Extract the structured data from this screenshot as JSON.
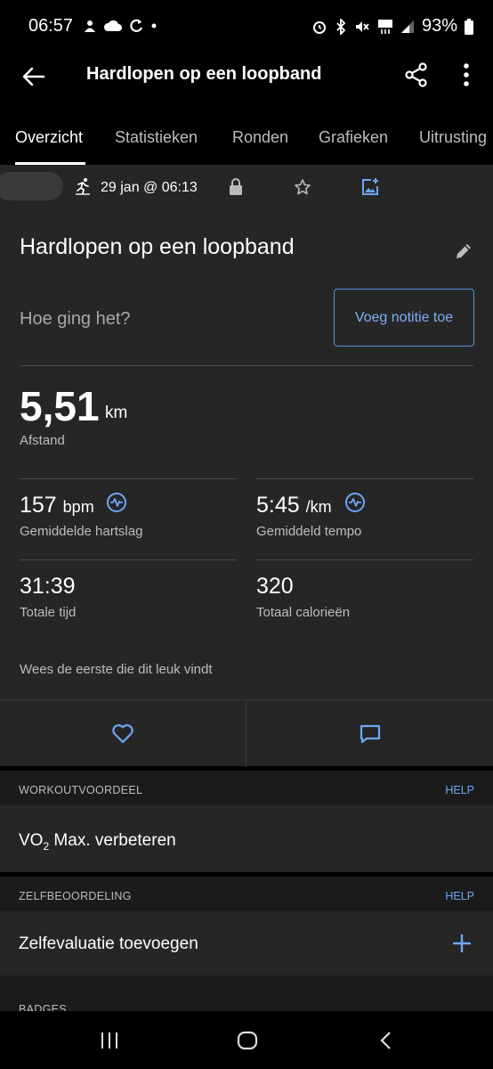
{
  "status_bar": {
    "time": "06:57",
    "battery": "93%"
  },
  "app_bar": {
    "title": "Hardlopen op een loopband"
  },
  "tabs": [
    {
      "label": "Overzicht",
      "active": true
    },
    {
      "label": "Statistieken",
      "active": false
    },
    {
      "label": "Ronden",
      "active": false
    },
    {
      "label": "Grafieken",
      "active": false
    },
    {
      "label": "Uitrusting",
      "active": false
    }
  ],
  "activity": {
    "date": "29 jan @ 06:13",
    "title": "Hardlopen op een loopband",
    "feel_prompt": "Hoe ging het?",
    "note_button": "Voeg notitie toe"
  },
  "stats": {
    "distance": {
      "value": "5,51",
      "unit": "km",
      "label": "Afstand"
    },
    "heart_rate": {
      "value": "157",
      "unit": "bpm",
      "label": "Gemiddelde hartslag"
    },
    "pace": {
      "value": "5:45",
      "unit": "/km",
      "label": "Gemiddeld tempo"
    },
    "time": {
      "value": "31:39",
      "label": "Totale tijd"
    },
    "calories": {
      "value": "320",
      "label": "Totaal calorieën"
    }
  },
  "social": {
    "likes_text": "Wees de eerste die dit leuk vindt"
  },
  "workout_benefit": {
    "title": "WORKOUTVOORDEEL",
    "help": "HELP",
    "value_prefix": "VO",
    "value_sub": "2",
    "value_suffix": " Max. verbeteren"
  },
  "self_eval": {
    "title": "ZELFBEOORDELING",
    "help": "HELP",
    "label": "Zelfevaluatie toevoegen"
  },
  "badges": {
    "title": "BADGES"
  },
  "colors": {
    "accent": "#6ea6f5",
    "card": "#262626",
    "section": "#1b1b1b"
  }
}
